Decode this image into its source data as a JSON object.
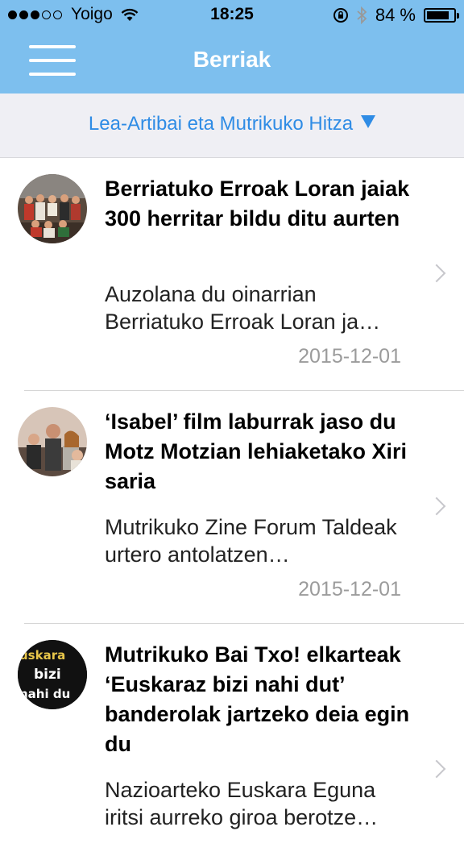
{
  "status_bar": {
    "carrier": "Yoigo",
    "time": "18:25",
    "battery": "84 %",
    "battery_level": 0.84
  },
  "nav": {
    "title": "Berriak"
  },
  "filter": {
    "selected": "Lea-Artibai eta Mutrikuko Hitza"
  },
  "news": [
    {
      "title": "Berriatuko Erroak Loran jaiak 300 herritar bildu ditu aurten",
      "excerpt": "Auzolana du oinarrian Berriatuko Erroak Loran ja…",
      "date": "2015-12-01"
    },
    {
      "title": "‘Isabel’ film laburrak jaso du Motz Motzian lehiaketako Xiri saria",
      "excerpt": "Mutrikuko Zine Forum Taldeak urtero antolatzen…",
      "date": "2015-12-01"
    },
    {
      "title": "Mutrikuko Bai Txo! elkarteak ‘Euskaraz bizi nahi dut’ banderolak jartzeko deia egin du",
      "excerpt": "Nazioarteko Euskara Eguna iritsi aurreko giroa berotze…",
      "date": "",
      "avatar_text": [
        "uskara",
        "bizi",
        "nahi du"
      ]
    }
  ]
}
